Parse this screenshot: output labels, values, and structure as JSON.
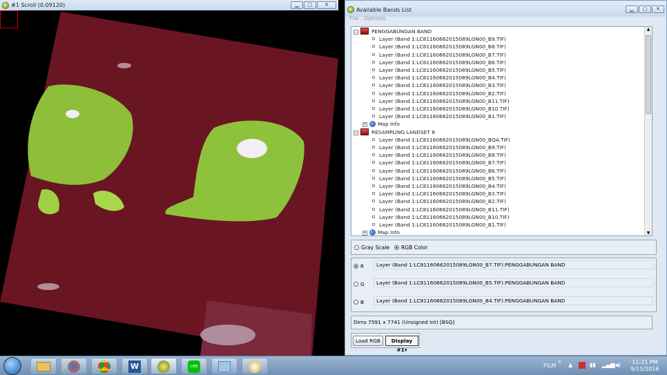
{
  "scroll_window": {
    "title": "#1 Scroll (0.09120)"
  },
  "bands_window": {
    "title": "Available Bands List",
    "menu": [
      "File",
      "Options"
    ],
    "groups": [
      {
        "name": "PENGGABUNGAN BAND",
        "layers": [
          "Layer (Band 1:LC81160662015089LGN00_B9.TIF)",
          "Layer (Band 1:LC81160662015089LGN00_B8.TIF)",
          "Layer (Band 1:LC81160662015089LGN00_B7.TIF)",
          "Layer (Band 1:LC81160662015089LGN00_B6.TIF)",
          "Layer (Band 1:LC81160662015089LGN00_B5.TIF)",
          "Layer (Band 1:LC81160662015089LGN00_B4.TIF)",
          "Layer (Band 1:LC81160662015089LGN00_B3.TIF)",
          "Layer (Band 1:LC81160662015089LGN00_B2.TIF)",
          "Layer (Band 1:LC81160662015089LGN00_B11.TIF)",
          "Layer (Band 1:LC81160662015089LGN00_B10.TIF)",
          "Layer (Band 1:LC81160662015089LGN00_B1.TIF)"
        ],
        "mapinfo": "Map Info"
      },
      {
        "name": "RESAMPLING LANDSET 8",
        "layers": [
          "Layer (Band 1:LC81160662015089LGN00_BQA.TIF)",
          "Layer (Band 1:LC81160662015089LGN00_B9.TIF)",
          "Layer (Band 1:LC81160662015089LGN00_B8.TIF)",
          "Layer (Band 1:LC81160662015089LGN00_B7.TIF)",
          "Layer (Band 1:LC81160662015089LGN00_B6.TIF)",
          "Layer (Band 1:LC81160662015089LGN00_B5.TIF)",
          "Layer (Band 1:LC81160662015089LGN00_B4.TIF)",
          "Layer (Band 1:LC81160662015089LGN00_B3.TIF)",
          "Layer (Band 1:LC81160662015089LGN00_B2.TIF)",
          "Layer (Band 1:LC81160662015089LGN00_B11.TIF)",
          "Layer (Band 1:LC81160662015089LGN00_B10.TIF)",
          "Layer (Band 1:LC81160662015089LGN00_B1.TIF)"
        ],
        "mapinfo": "Map Info"
      }
    ],
    "mode": {
      "gray": "Gray Scale",
      "rgb": "RGB Color",
      "selected": "RGB Color"
    },
    "rgb": [
      {
        "channel": "R",
        "value": "Layer (Band 1:LC81160662015089LGN00_B7.TIF):PENGGABUNGAN BAND",
        "selected": true
      },
      {
        "channel": "G",
        "value": "Layer (Band 1:LC81160662015089LGN00_B5.TIF):PENGGABUNGAN BAND",
        "selected": false
      },
      {
        "channel": "B",
        "value": "Layer (Band 1:LC81160662015089LGN00_B4.TIF):PENGGABUNGAN BAND",
        "selected": false
      }
    ],
    "dims_label": "Dims",
    "dims_value": "7591 x 7741 (Unsigned Int) [BSQ]",
    "load_button": "Load RGB",
    "display_button": "Display #1"
  },
  "taskbar": {
    "lang": "FILM",
    "time": "11:21 PM",
    "date": "9/15/2016",
    "apps": [
      "start-orb-icon",
      "explorer-icon",
      "firefox-icon",
      "chrome-icon",
      "word-icon",
      "envi-icon",
      "line-icon",
      "files-icon",
      "paint-icon"
    ]
  }
}
